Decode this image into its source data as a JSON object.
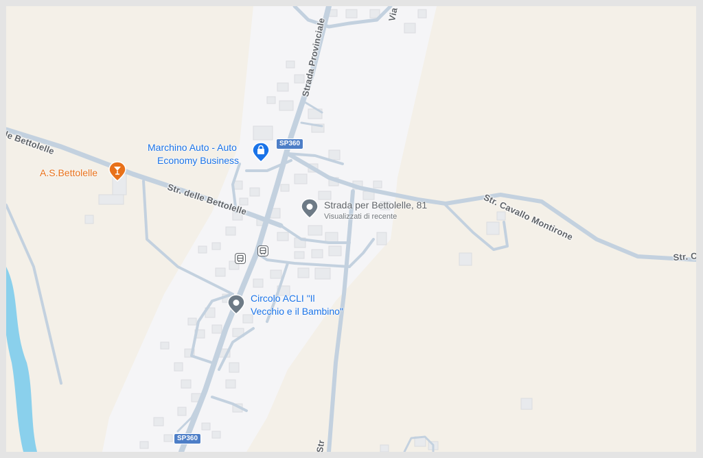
{
  "map": {
    "roads": {
      "provinciale": "Strada Provinciale",
      "bettolelle_west": "lle Bettolelle",
      "bettolelle_main": "Str. delle Bettolelle",
      "cavallo": "Str. Cavallo Montirone",
      "str_c_edge": "Str. C",
      "via_edge": "Via",
      "bottom_edge": "Str"
    },
    "shields": [
      {
        "label": "SP360"
      },
      {
        "label": "SP360"
      }
    ],
    "places": {
      "marchino": {
        "line1": "Marchino Auto - Auto",
        "line2": "Economy Business",
        "icon": "shopping-bag-icon"
      },
      "bettolelle_bar": {
        "label": "A.S.Bettolelle",
        "icon": "cocktail-icon"
      },
      "strada_per": {
        "label": "Strada per Bettolelle, 81",
        "sub": "Visualizzati di recente",
        "icon": "recent-place-pin-icon"
      },
      "circolo": {
        "line1": "Circolo ACLI \"Il",
        "line2": "Vecchio e il Bambino\"",
        "icon": "place-pin-icon"
      }
    },
    "transit_icons": [
      "bus-stop-icon",
      "bus-stop-icon"
    ],
    "colors": {
      "land": "#f4f0e8",
      "urban": "#f5f5f7",
      "road": "#c3d1df",
      "water": "#8ad0ec",
      "building": "#e8eaed",
      "poi_blue": "#1a73e8",
      "poi_orange": "#e8711a",
      "pin_grey": "#6d7a86"
    }
  }
}
